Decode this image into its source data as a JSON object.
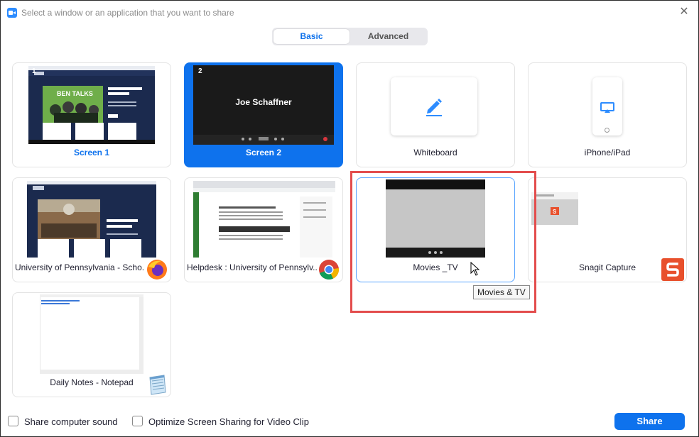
{
  "window": {
    "title": "Select a window or an application that you want to share",
    "close_glyph": "✕"
  },
  "tabs": [
    {
      "label": "Basic",
      "active": true
    },
    {
      "label": "Advanced",
      "active": false
    }
  ],
  "cards": {
    "screen1": {
      "label": "Screen 1",
      "number": "1"
    },
    "screen2": {
      "label": "Screen 2",
      "number": "2",
      "content_text": "Joe Schaffner"
    },
    "whiteboard": {
      "label": "Whiteboard"
    },
    "iphone": {
      "label": "iPhone/iPad"
    },
    "firefox": {
      "label": "University of Pennsylvania - Scho..."
    },
    "chrome": {
      "label": "Helpdesk : University of Pennsylv..."
    },
    "movies": {
      "label": "Movies _TV"
    },
    "snagit": {
      "label": "Snagit Capture"
    },
    "notepad": {
      "label": "Daily Notes - Notepad"
    }
  },
  "tooltip": {
    "text": "Movies & TV"
  },
  "footer": {
    "share_sound_label": "Share computer sound",
    "optimize_label": "Optimize Screen Sharing for Video Clip",
    "share_button": "Share"
  },
  "colors": {
    "accent": "#0e72ed",
    "highlight_box": "#e34d4d"
  },
  "icons": {
    "app": "zoom-icon",
    "close": "close-icon",
    "whiteboard": "pen-icon",
    "iphone": "airplay-icon",
    "firefox": "firefox-icon",
    "chrome": "chrome-icon",
    "snagit": "snagit-icon",
    "notepad": "notepad-icon"
  }
}
